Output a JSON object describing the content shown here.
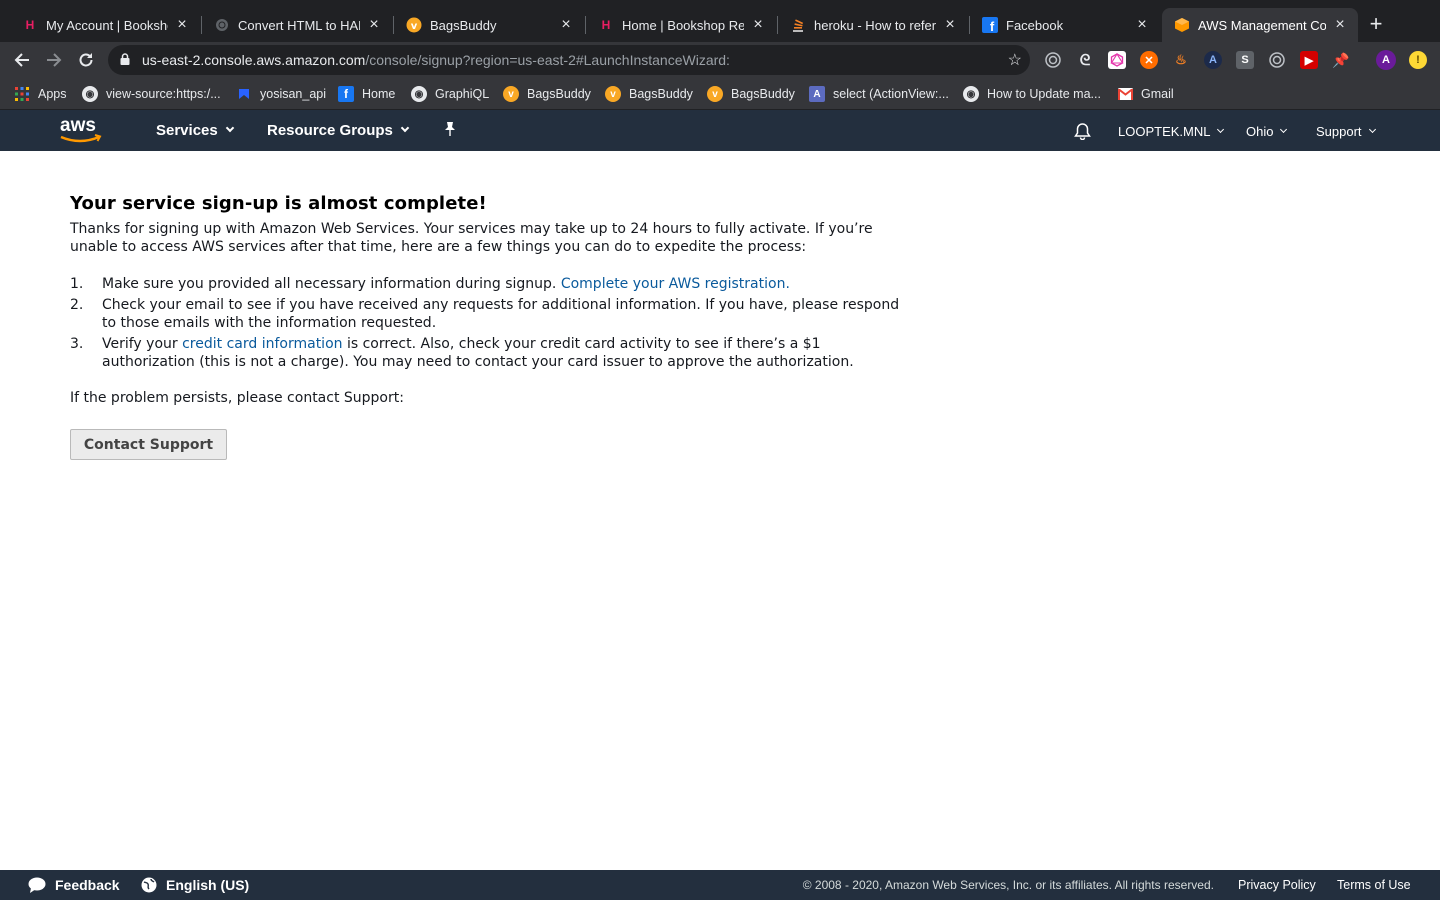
{
  "browser": {
    "tabs": [
      {
        "title": "My Account | Bookshop",
        "icon": "heroku-icon",
        "color": "#e91e63"
      },
      {
        "title": "Convert HTML to HAML",
        "icon": "globe-icon",
        "color": "#9aa0a6"
      },
      {
        "title": "BagsBuddy",
        "icon": "bagsbuddy-icon",
        "color": "#f9a825"
      },
      {
        "title": "Home | Bookshop Resp",
        "icon": "heroku-icon",
        "color": "#e91e63"
      },
      {
        "title": "heroku - How to referen",
        "icon": "stackoverflow-icon",
        "color": "#f48024"
      },
      {
        "title": "Facebook",
        "icon": "facebook-icon",
        "color": "#1877f2"
      },
      {
        "title": "AWS Management Cons",
        "icon": "aws-cube-icon",
        "color": "#ff9900"
      }
    ],
    "url_host": "us-east-2.console.aws.amazon.com",
    "url_path": "/console/signup?region=us-east-2#LaunchInstanceWizard:",
    "bookmarks": [
      {
        "label": "Apps",
        "icon": "apps-grid-icon"
      },
      {
        "label": "view-source:https:/...",
        "icon": "globe-icon"
      },
      {
        "label": "yosisan_api",
        "icon": "bookmark-blue-icon"
      },
      {
        "label": "Home",
        "icon": "facebook-icon"
      },
      {
        "label": "GraphiQL",
        "icon": "globe-icon"
      },
      {
        "label": "BagsBuddy",
        "icon": "bagsbuddy-icon"
      },
      {
        "label": "BagsBuddy",
        "icon": "bagsbuddy-icon"
      },
      {
        "label": "BagsBuddy",
        "icon": "bagsbuddy-icon"
      },
      {
        "label": "select (ActionView:...",
        "icon": "api-doc-icon"
      },
      {
        "label": "How to Update ma...",
        "icon": "globe-icon"
      },
      {
        "label": "Gmail",
        "icon": "gmail-icon"
      }
    ],
    "profile_initial": "A"
  },
  "awsnav": {
    "services": "Services",
    "resource_groups": "Resource Groups",
    "account": "LOOPTEK.MNL",
    "region": "Ohio",
    "support": "Support"
  },
  "content": {
    "heading": "Your service sign-up is almost complete!",
    "intro": "Thanks for signing up with Amazon Web Services. Your services may take up to 24 hours to fully activate. If you’re unable to access AWS services after that time, here are a few things you can do to expedite the process:",
    "steps": [
      {
        "num": "1.",
        "before": "Make sure you provided all necessary information during signup. ",
        "link": "Complete your AWS registration.",
        "after": ""
      },
      {
        "num": "2.",
        "before": "Check your email to see if you have received any requests for additional information. If you have, please respond to those emails with the information requested.",
        "link": "",
        "after": ""
      },
      {
        "num": "3.",
        "before": "Verify your ",
        "link": "credit card information",
        "after": " is correct. Also, check your credit card activity to see if there’s a $1 authorization (this is not a charge). You may need to contact your card issuer to approve the authorization."
      }
    ],
    "persist_text": "If the problem persists, please contact Support:",
    "contact_button": "Contact Support"
  },
  "footer": {
    "feedback": "Feedback",
    "language": "English (US)",
    "copyright": "© 2008 - 2020, Amazon Web Services, Inc. or its affiliates. All rights reserved.",
    "privacy": "Privacy Policy",
    "terms": "Terms of Use"
  },
  "colors": {
    "aws_nav_bg": "#232f3e",
    "aws_orange": "#ff9900",
    "link": "#0a5a9c"
  }
}
